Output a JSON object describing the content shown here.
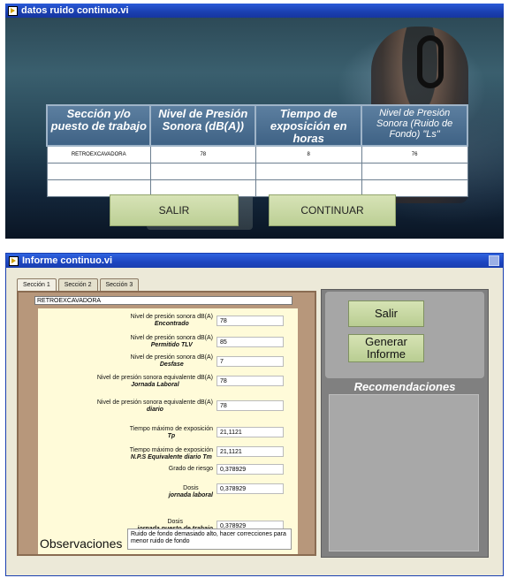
{
  "window1": {
    "title": "datos ruido continuo.vi",
    "table": {
      "headers": [
        "Sección y/o puesto de trabajo",
        "Nivel de Presión Sonora (dB(A))",
        "Tiempo de exposición en horas",
        "Nivel de Presión Sonora (Ruido de Fondo) \"Ls\""
      ],
      "rows": [
        [
          "RETROEXCAVADORA",
          "78",
          "8",
          "76"
        ],
        [
          "",
          "",
          "",
          ""
        ],
        [
          "",
          "",
          "",
          ""
        ]
      ]
    },
    "buttons": {
      "salir": "SALIR",
      "continuar": "CONTINUAR"
    }
  },
  "window2": {
    "title": "Informe continuo.vi",
    "tabs": [
      "Sección 1",
      "Sección 2",
      "Sección 3"
    ],
    "section_value": "RETROEXCAVADORA",
    "fields": [
      {
        "line1": "Nivel de presión sonora dB(A)",
        "line2": "Encontrado",
        "value": "78"
      },
      {
        "line1": "Nivel de presión sonora dB(A)",
        "line2": "Permitido TLV",
        "value": "85"
      },
      {
        "line1": "Nivel de presión sonora dB(A)",
        "line2": "Desfase",
        "value": "7"
      },
      {
        "line1": "Nivel de presión sonora equivalente dB(A)",
        "line2": "Jornada Laboral",
        "value": "78"
      },
      {
        "line1": "Nivel de presión sonora equivalente dB(A)",
        "line2": "diario",
        "value": "78"
      },
      {
        "line1": "Tiempo máximo de exposición",
        "line2": "Tp",
        "value": "21,1121"
      },
      {
        "line1": "Tiempo máximo de exposición",
        "line2": "N.P.S Equivalente diario Tm",
        "value": "21,1121"
      },
      {
        "line1": "Grado de riesgo",
        "line2": "",
        "value": "0,378929"
      },
      {
        "line1": "Dosis",
        "line2": "jornada laboral",
        "value": "0,378929"
      },
      {
        "line1": "Dosis",
        "line2": "jornada puesto de trabajo",
        "value": "0,378929"
      }
    ],
    "observaciones_label": "Observaciones",
    "observaciones_value": "Ruido de fondo demasiado alto, hacer correcciones para menor ruido de fondo",
    "buttons": {
      "salir": "Salir",
      "generar": "Generar Informe"
    },
    "recomendaciones_title": "Recomendaciones"
  }
}
